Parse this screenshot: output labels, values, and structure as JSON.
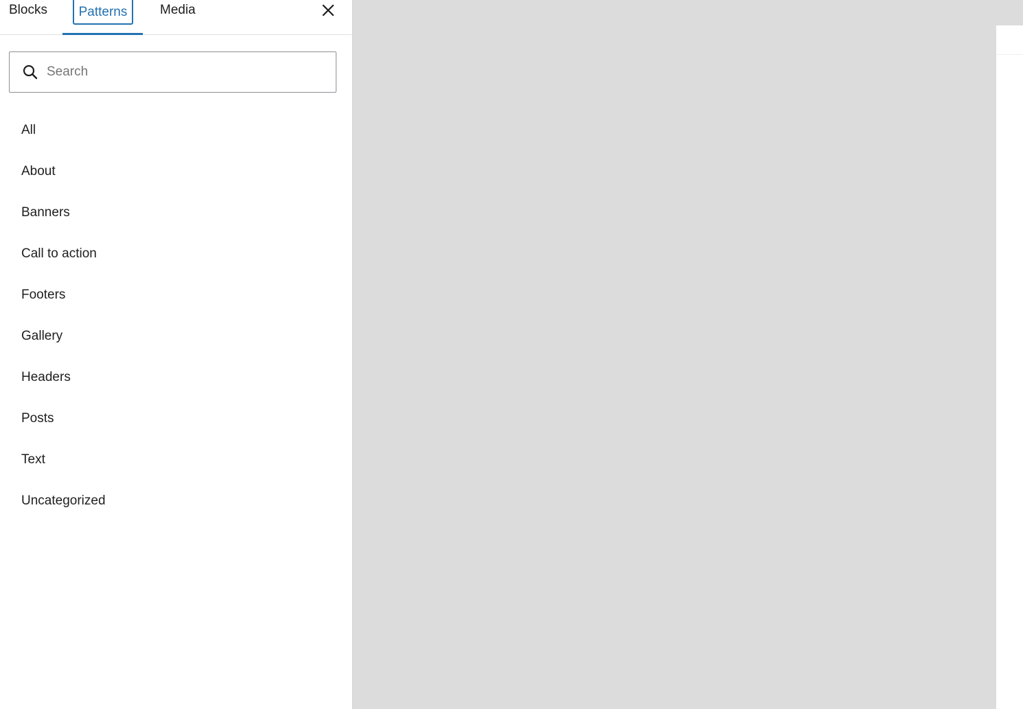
{
  "tabs": [
    {
      "label": "Blocks",
      "active": false
    },
    {
      "label": "Patterns",
      "active": true
    },
    {
      "label": "Media",
      "active": false
    }
  ],
  "close_icon": "close-icon",
  "search": {
    "placeholder": "Search",
    "value": "",
    "icon": "search-icon"
  },
  "categories": [
    "All",
    "About",
    "Banners",
    "Call to action",
    "Footers",
    "Gallery",
    "Headers",
    "Posts",
    "Text",
    "Uncategorized"
  ],
  "colors": {
    "accent": "#2271b1",
    "text": "#1e1e1e",
    "canvas_background": "#dcdcdc",
    "panel_background": "#ffffff"
  }
}
